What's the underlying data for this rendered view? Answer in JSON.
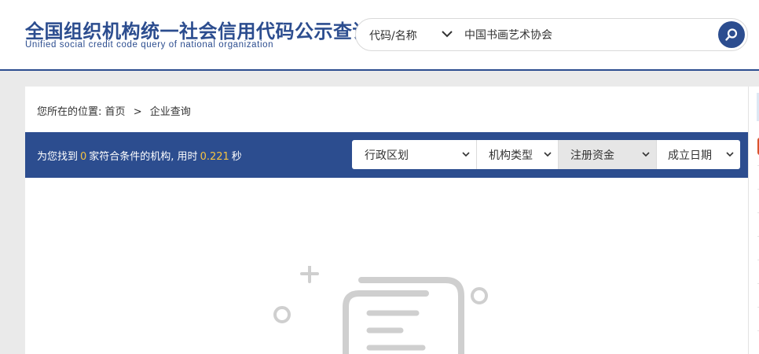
{
  "header": {
    "title": "全国组织机构统一社会信用代码公示查询",
    "subtitle": "Unified social credit code query of national organization"
  },
  "search": {
    "type_label": "代码/名称",
    "value": "中国书画艺术协会",
    "icons": {
      "dropdown": "chevron-down-icon",
      "submit": "search-icon"
    }
  },
  "breadcrumb": {
    "prefix": "您所在的位置:",
    "items": [
      "首页",
      "企业查询"
    ],
    "separator": ">"
  },
  "results": {
    "text_before": "为您找到",
    "count": "0",
    "text_middle": "家符合条件的机构, 用时",
    "time": "0.221",
    "text_after": "秒"
  },
  "filters": [
    {
      "label": "行政区划",
      "active": false
    },
    {
      "label": "机构类型",
      "active": false
    },
    {
      "label": "注册资金",
      "active": true
    },
    {
      "label": "成立日期",
      "active": false
    }
  ],
  "colors": {
    "brand": "#2c4d8f",
    "highlight": "#f5c342",
    "empty_illustration": "#cfcfcf"
  }
}
